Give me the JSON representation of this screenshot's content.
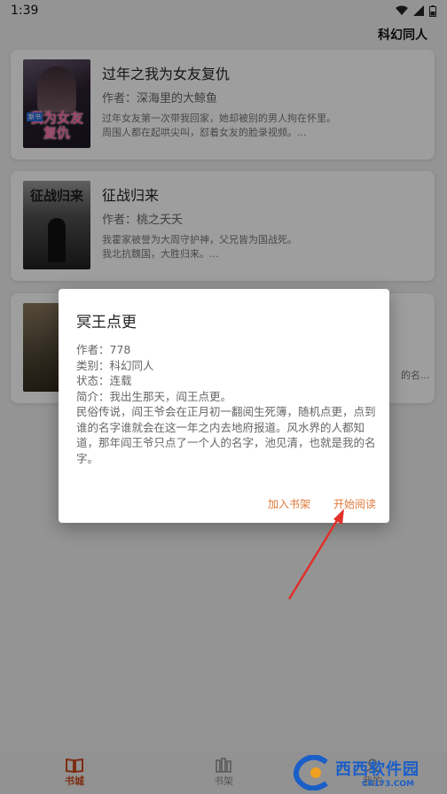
{
  "status": {
    "time": "1:39"
  },
  "appbar": {
    "category": "科幻同人"
  },
  "books": [
    {
      "title": "过年之我为女友复仇",
      "author": "作者：深海里的大鲸鱼",
      "desc": "过年女友第一次带我回家，她却被别的男人拘在怀里。\n        周围人都在起哄尖叫，怼着女友的脸录视频。...",
      "cover_text": "我为女友复仇",
      "cover_tag": "新书"
    },
    {
      "title": "征战归来",
      "author": "作者：桃之夭夭",
      "desc": "我霍家被誉为大周守护神，父兄皆为国战死。\n        我北抗魏国，大胜归来。...",
      "cover_text": "征战归来"
    },
    {
      "desc_tail": "的名..."
    }
  ],
  "dialog": {
    "title": "冥王点更",
    "author": "作者：778",
    "category": "类别：科幻同人",
    "state": "状态：连载",
    "intro": "简介：我出生那天，阎王点更。",
    "desc": "民俗传说，阎王爷会在正月初一翻阅生死簿，随机点更，点到谁的名字谁就会在这一年之内去地府报道。风水界的人都知道，那年阎王爷只点了一个人的名字，池见清，也就是我的名字。",
    "add_shelf": "加入书架",
    "start_read": "开始阅读"
  },
  "nav": {
    "items": [
      {
        "label": "书城",
        "icon": "book-open-icon",
        "active": true
      },
      {
        "label": "书架",
        "icon": "bookshelf-icon",
        "active": false
      },
      {
        "label": "我的",
        "icon": "user-icon",
        "active": false
      }
    ]
  },
  "watermark": {
    "brand": "西西软件园",
    "url": "CR173.COM"
  },
  "colors": {
    "accent": "#e07a3a",
    "nav_active": "#c84a1e",
    "arrow": "#e0302a"
  }
}
